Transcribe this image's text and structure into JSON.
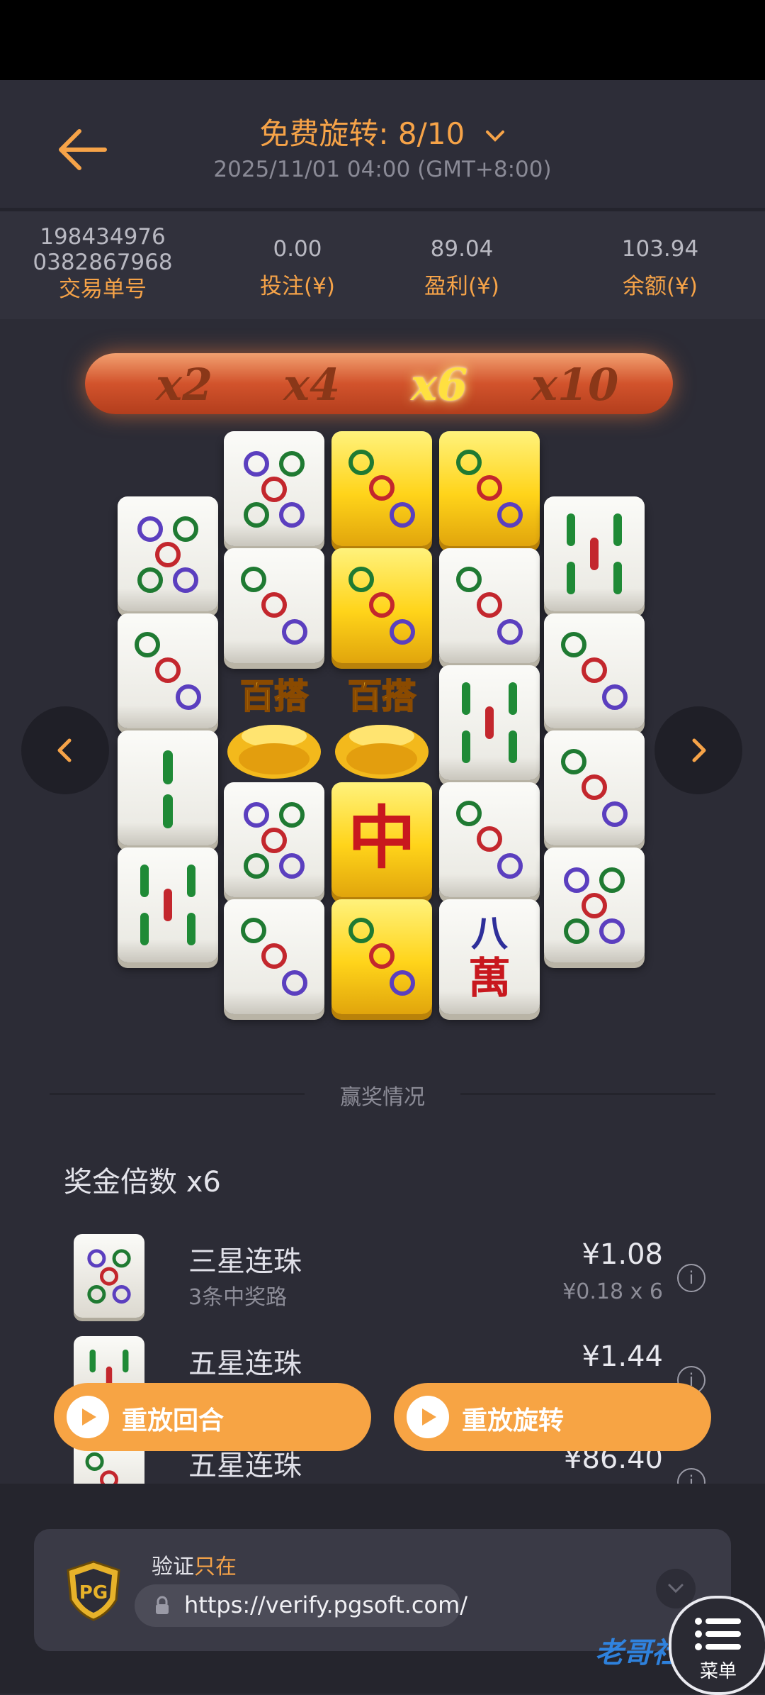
{
  "header": {
    "title": "免费旋转: 8/10",
    "datetime": "2025/11/01 04:00 (GMT+8:00)"
  },
  "stats": {
    "transaction_id_line1": "198434976",
    "transaction_id_line2": "0382867968",
    "transaction_label": "交易单号",
    "bet_value": "0.00",
    "bet_label": "投注(¥)",
    "profit_value": "89.04",
    "profit_label": "盈利(¥)",
    "balance_value": "103.94",
    "balance_label": "余额(¥)"
  },
  "multipliers": [
    "x2",
    "x4",
    "x6",
    "x10"
  ],
  "active_multiplier": "x6",
  "wild_text": "百搭",
  "wan_tile": {
    "top": "八",
    "bottom": "萬"
  },
  "zhong_tile": "中",
  "win_section": {
    "divider_label": "赢奖情况",
    "multiplier_title": "奖金倍数 x6",
    "rows": [
      {
        "name": "三星连珠",
        "amount": "¥1.08",
        "lines": "3条中奖路",
        "calc": "¥0.18 x 6"
      },
      {
        "name": "五星连珠",
        "amount": "¥1.44"
      },
      {
        "name": "五星连珠",
        "amount": "¥86.40"
      }
    ]
  },
  "buttons": {
    "replay_round": "重放回合",
    "replay_spin": "重放旋转"
  },
  "verify": {
    "label_prefix": "验证",
    "label_highlight": "只在",
    "url": "https://verify.pgsoft.com/",
    "badge": "PG"
  },
  "menu_label": "菜单",
  "watermark": "老哥社区",
  "colors": {
    "accent": "#f6a348",
    "background": "#2c2c36",
    "tile_gold": "#ffd41a",
    "multiplier_bar": "#d2532c"
  }
}
